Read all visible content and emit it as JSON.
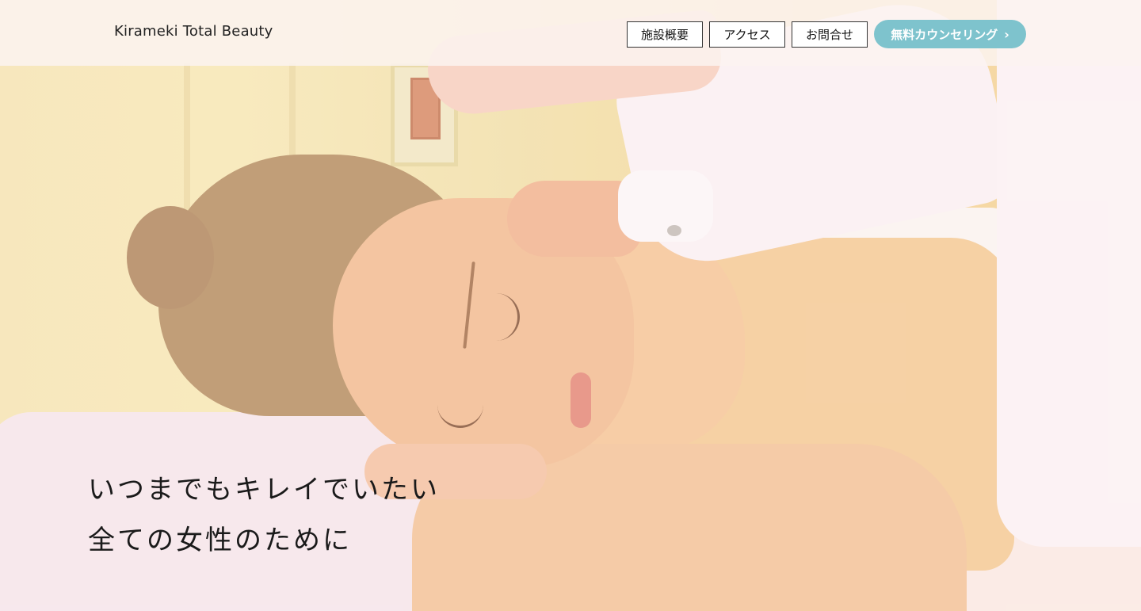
{
  "header": {
    "logo": "Kirameki Total Beauty",
    "nav": [
      {
        "label": "施設概要"
      },
      {
        "label": "アクセス"
      },
      {
        "label": "お問合せ"
      }
    ],
    "cta": {
      "label": "無料カウンセリング",
      "icon": "chevron-right-icon",
      "color": "#7ec3cd"
    }
  },
  "hero": {
    "image": "spa-massage-photo",
    "catchcopy": {
      "line1": "いつまでもキレイでいたい",
      "line2": "全ての女性のために"
    }
  }
}
